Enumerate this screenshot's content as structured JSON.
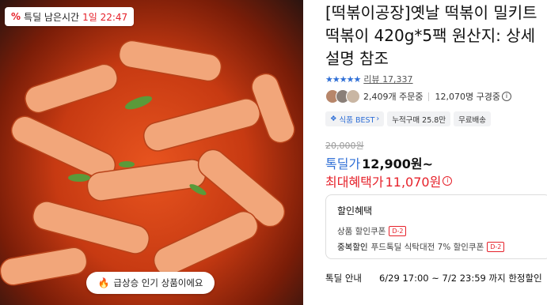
{
  "badge": {
    "prefix": "특딜 남은시간",
    "time": "1일 22:47"
  },
  "popular_badge": "급상승 인기 상품이에요",
  "product": {
    "title": "[떡볶이공장]옛날 떡볶이 밀키트 떡볶이 420g*5팩 원산지: 상세설명 참조",
    "stars": "★★★★★",
    "review_label": "리뷰",
    "review_count": "17,337",
    "orders": "2,409개 주문중",
    "viewers": "12,070명 구경중",
    "tags": [
      "식품 BEST",
      "누적구매 25.8만",
      "무료배송"
    ],
    "original_price": "20,000원",
    "deal_label": "톡딜가",
    "deal_price": "12,900원~",
    "max_label": "최대혜택가",
    "max_price": "11,070원"
  },
  "discount": {
    "heading": "할인혜택",
    "rows": [
      {
        "label": "",
        "text": "상품 할인쿠폰",
        "badge": "D-2"
      },
      {
        "label": "중복할인",
        "text": "푸드톡딜 식탁대전 7% 할인쿠폰",
        "badge": "D-2"
      }
    ]
  },
  "notice": {
    "label": "톡딜 안내",
    "text": "6/29 17:00 ~ 7/2 23:59 까지 한정할인"
  },
  "colors": {
    "accent_red": "#e6212a",
    "accent_blue": "#2f6fd6"
  },
  "icons": {
    "fire": "fire-icon",
    "percent": "percent-icon",
    "info": "info-icon"
  }
}
